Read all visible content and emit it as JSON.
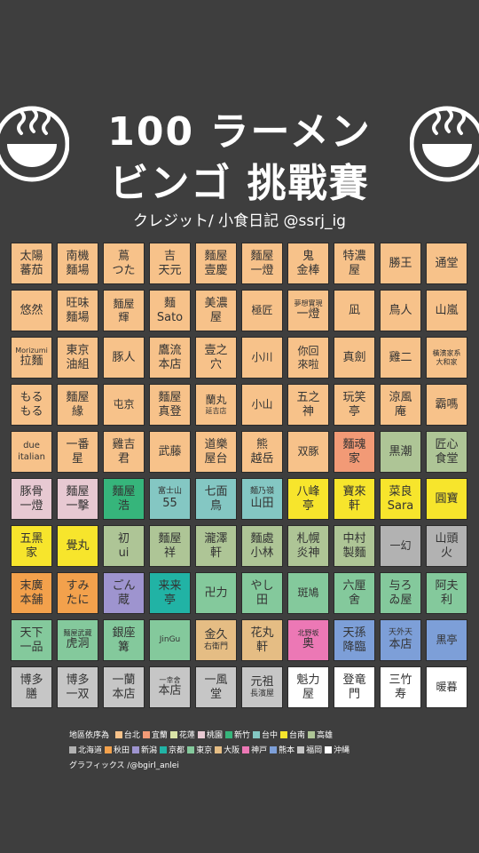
{
  "header": {
    "title_line1": "100 ラーメン",
    "title_line2": "ビンゴ 挑戰賽",
    "credit": "クレジット/ 小食日記 @ssrj_ig"
  },
  "colors": {
    "background": "#3e3e3e",
    "taipei": "#f7c28a",
    "yilan": "#f29a76",
    "hualien": "#d9e4a7",
    "taoyuan": "#e7c9d2",
    "hsinchu": "#36b57b",
    "taichung": "#84c7c3",
    "tainan": "#f7e52c",
    "kaohsiung": "#aec596",
    "hokkaido": "#b2b2b2",
    "akita": "#f3a14c",
    "niigata": "#9e94cf",
    "kyoto": "#21b3a5",
    "tokyo": "#84c99c",
    "osaka": "#e5bd84",
    "kobe": "#ec78b5",
    "kumamoto": "#7d9fd8",
    "fukuoka": "#c6c6c6",
    "okinawa": "#ffffff"
  },
  "cells": [
    {
      "lines": [
        "太陽",
        "蕃茄"
      ],
      "color": "#f7c28a",
      "size": 13
    },
    {
      "lines": [
        "南機",
        "麵場"
      ],
      "color": "#f7c28a",
      "size": 13
    },
    {
      "lines": [
        "蔦",
        "つた"
      ],
      "color": "#f7c28a",
      "size": 13
    },
    {
      "lines": [
        "吉",
        "天元"
      ],
      "color": "#f7c28a",
      "size": 13
    },
    {
      "lines": [
        "麵屋",
        "壹慶"
      ],
      "color": "#f7c28a",
      "size": 13
    },
    {
      "lines": [
        "麵屋",
        "一燈"
      ],
      "color": "#f7c28a",
      "size": 13
    },
    {
      "lines": [
        "鬼",
        "金棒"
      ],
      "color": "#f7c28a",
      "size": 13
    },
    {
      "lines": [
        "特濃",
        "屋"
      ],
      "color": "#f7c28a",
      "size": 13
    },
    {
      "lines": [
        "勝王"
      ],
      "color": "#f7c28a",
      "size": 13
    },
    {
      "lines": [
        "通堂"
      ],
      "color": "#f7c28a",
      "size": 13
    },
    {
      "lines": [
        "悠然"
      ],
      "color": "#f7c28a",
      "size": 13
    },
    {
      "lines": [
        "旺味",
        "麵場"
      ],
      "color": "#f7c28a",
      "size": 13
    },
    {
      "lines": [
        "麵屋",
        "輝"
      ],
      "color": "#f7c28a",
      "size": 12
    },
    {
      "lines": [
        "麵",
        "Sato"
      ],
      "color": "#f7c28a",
      "size": 13
    },
    {
      "lines": [
        "美濃",
        "屋"
      ],
      "color": "#f7c28a",
      "size": 13
    },
    {
      "lines": [
        "極匠"
      ],
      "color": "#f7c28a",
      "size": 12
    },
    {
      "lines": [
        "夢想實現",
        "一燈"
      ],
      "color": "#f7c28a",
      "size": 8,
      "size2": 13
    },
    {
      "lines": [
        "凪"
      ],
      "color": "#f7c28a",
      "size": 13
    },
    {
      "lines": [
        "鳥人"
      ],
      "color": "#f7c28a",
      "size": 13
    },
    {
      "lines": [
        "山嵐"
      ],
      "color": "#f7c28a",
      "size": 13
    },
    {
      "lines": [
        "Morizumi",
        "拉麵"
      ],
      "color": "#f7c28a",
      "size": 8,
      "size2": 13
    },
    {
      "lines": [
        "東京",
        "油組"
      ],
      "color": "#f7c28a",
      "size": 13
    },
    {
      "lines": [
        "豚人"
      ],
      "color": "#f7c28a",
      "size": 13
    },
    {
      "lines": [
        "鷹流",
        "本店"
      ],
      "color": "#f7c28a",
      "size": 13
    },
    {
      "lines": [
        "壹之",
        "穴"
      ],
      "color": "#f7c28a",
      "size": 13
    },
    {
      "lines": [
        "小川"
      ],
      "color": "#f7c28a",
      "size": 12
    },
    {
      "lines": [
        "你回",
        "來啦"
      ],
      "color": "#f7c28a",
      "size": 12
    },
    {
      "lines": [
        "真劍"
      ],
      "color": "#f7c28a",
      "size": 13
    },
    {
      "lines": [
        "雞二"
      ],
      "color": "#f7c28a",
      "size": 13
    },
    {
      "lines": [
        "橫濱家系",
        "大和家"
      ],
      "color": "#f7c28a",
      "size": 8
    },
    {
      "lines": [
        "もる",
        "もる"
      ],
      "color": "#f7c28a",
      "size": 13
    },
    {
      "lines": [
        "麵屋",
        "緣"
      ],
      "color": "#f7c28a",
      "size": 13
    },
    {
      "lines": [
        "屯京"
      ],
      "color": "#f7c28a",
      "size": 12
    },
    {
      "lines": [
        "麵屋",
        "真登"
      ],
      "color": "#f7c28a",
      "size": 13
    },
    {
      "lines": [
        "蘭丸",
        "延吉店"
      ],
      "color": "#f7c28a",
      "size": 12,
      "size2": 8
    },
    {
      "lines": [
        "小山"
      ],
      "color": "#f7c28a",
      "size": 12
    },
    {
      "lines": [
        "五之",
        "神"
      ],
      "color": "#f7c28a",
      "size": 13
    },
    {
      "lines": [
        "玩笑",
        "亭"
      ],
      "color": "#f7c28a",
      "size": 13
    },
    {
      "lines": [
        "涼風",
        "庵"
      ],
      "color": "#f7c28a",
      "size": 13
    },
    {
      "lines": [
        "霸嗎"
      ],
      "color": "#f7c28a",
      "size": 13
    },
    {
      "lines": [
        "due",
        "italian"
      ],
      "color": "#f7c28a",
      "size": 10
    },
    {
      "lines": [
        "一番",
        "星"
      ],
      "color": "#f7c28a",
      "size": 13
    },
    {
      "lines": [
        "雞吉",
        "君"
      ],
      "color": "#f7c28a",
      "size": 13
    },
    {
      "lines": [
        "武藤"
      ],
      "color": "#f7c28a",
      "size": 13
    },
    {
      "lines": [
        "道樂",
        "屋台"
      ],
      "color": "#f7c28a",
      "size": 13
    },
    {
      "lines": [
        "熊",
        "越岳"
      ],
      "color": "#f7c28a",
      "size": 13
    },
    {
      "lines": [
        "双豚"
      ],
      "color": "#f7c28a",
      "size": 12
    },
    {
      "lines": [
        "麵魂",
        "家"
      ],
      "color": "#f29a76",
      "size": 13
    },
    {
      "lines": [
        "黒潮"
      ],
      "color": "#aec596",
      "size": 13
    },
    {
      "lines": [
        "匠心",
        "食堂"
      ],
      "color": "#aec596",
      "size": 13
    },
    {
      "lines": [
        "豚骨",
        "一燈"
      ],
      "color": "#e7c9d2",
      "size": 13
    },
    {
      "lines": [
        "麵屋",
        "一擊"
      ],
      "color": "#e7c9d2",
      "size": 13
    },
    {
      "lines": [
        "麵屋",
        "浩"
      ],
      "color": "#36b57b",
      "size": 13
    },
    {
      "lines": [
        "富士山",
        "55"
      ],
      "color": "#84c7c3",
      "size": 9,
      "size2": 13
    },
    {
      "lines": [
        "七面",
        "鳥"
      ],
      "color": "#84c7c3",
      "size": 13
    },
    {
      "lines": [
        "麵乃嶺",
        "山田"
      ],
      "color": "#84c7c3",
      "size": 9,
      "size2": 13
    },
    {
      "lines": [
        "八峰",
        "亭"
      ],
      "color": "#f7e52c",
      "size": 13
    },
    {
      "lines": [
        "寶來",
        "軒"
      ],
      "color": "#f7e52c",
      "size": 13
    },
    {
      "lines": [
        "菜良",
        "Sara"
      ],
      "color": "#f7e52c",
      "size": 13
    },
    {
      "lines": [
        "圓寶"
      ],
      "color": "#f7e52c",
      "size": 13
    },
    {
      "lines": [
        "五黑",
        "家"
      ],
      "color": "#f7e52c",
      "size": 13
    },
    {
      "lines": [
        "覺丸"
      ],
      "color": "#f7e52c",
      "size": 13
    },
    {
      "lines": [
        "初",
        "ui"
      ],
      "color": "#aec596",
      "size": 13
    },
    {
      "lines": [
        "麵屋",
        "祥"
      ],
      "color": "#aec596",
      "size": 13
    },
    {
      "lines": [
        "瀧澤",
        "軒"
      ],
      "color": "#aec596",
      "size": 13
    },
    {
      "lines": [
        "麵處",
        "小林"
      ],
      "color": "#aec596",
      "size": 13
    },
    {
      "lines": [
        "札幌",
        "炎神"
      ],
      "color": "#aec596",
      "size": 13
    },
    {
      "lines": [
        "中村",
        "製麵"
      ],
      "color": "#aec596",
      "size": 13
    },
    {
      "lines": [
        "一幻"
      ],
      "color": "#b2b2b2",
      "size": 12
    },
    {
      "lines": [
        "山頭",
        "火"
      ],
      "color": "#b2b2b2",
      "size": 13
    },
    {
      "lines": [
        "末廣",
        "本舗"
      ],
      "color": "#f3a14c",
      "size": 13
    },
    {
      "lines": [
        "すみ",
        "たに"
      ],
      "color": "#f3a14c",
      "size": 13
    },
    {
      "lines": [
        "ごん",
        "蔵"
      ],
      "color": "#9e94cf",
      "size": 13
    },
    {
      "lines": [
        "来来",
        "亭"
      ],
      "color": "#21b3a5",
      "size": 13
    },
    {
      "lines": [
        "卍力"
      ],
      "color": "#84c99c",
      "size": 13
    },
    {
      "lines": [
        "やし",
        "田"
      ],
      "color": "#84c99c",
      "size": 13
    },
    {
      "lines": [
        "斑鳩"
      ],
      "color": "#84c99c",
      "size": 12
    },
    {
      "lines": [
        "六厘",
        "舍"
      ],
      "color": "#84c99c",
      "size": 13
    },
    {
      "lines": [
        "与ろ",
        "ゐ屋"
      ],
      "color": "#84c99c",
      "size": 13
    },
    {
      "lines": [
        "阿夫",
        "利"
      ],
      "color": "#84c99c",
      "size": 13
    },
    {
      "lines": [
        "天下",
        "一品"
      ],
      "color": "#84c99c",
      "size": 13
    },
    {
      "lines": [
        "麵屋武藏",
        "虎洞"
      ],
      "color": "#84c99c",
      "size": 8,
      "size2": 13
    },
    {
      "lines": [
        "銀座",
        "篝"
      ],
      "color": "#84c99c",
      "size": 13
    },
    {
      "lines": [
        "JinGu"
      ],
      "color": "#84c99c",
      "size": 9
    },
    {
      "lines": [
        "金久",
        "右衛門"
      ],
      "color": "#e5bd84",
      "size": 13,
      "size2": 9
    },
    {
      "lines": [
        "花丸",
        "軒"
      ],
      "color": "#e5bd84",
      "size": 13
    },
    {
      "lines": [
        "北野坂",
        "奥"
      ],
      "color": "#ec78b5",
      "size": 8,
      "size2": 13
    },
    {
      "lines": [
        "天孫",
        "降臨"
      ],
      "color": "#7d9fd8",
      "size": 13
    },
    {
      "lines": [
        "天外天",
        "本店"
      ],
      "color": "#7d9fd8",
      "size": 9,
      "size2": 13
    },
    {
      "lines": [
        "黒亭"
      ],
      "color": "#7d9fd8",
      "size": 12
    },
    {
      "lines": [
        "博多",
        "膳"
      ],
      "color": "#c6c6c6",
      "size": 13
    },
    {
      "lines": [
        "博多",
        "一双"
      ],
      "color": "#c6c6c6",
      "size": 13
    },
    {
      "lines": [
        "一蘭",
        "本店"
      ],
      "color": "#c6c6c6",
      "size": 13
    },
    {
      "lines": [
        "一幸舍",
        "本店"
      ],
      "color": "#c6c6c6",
      "size": 8,
      "size2": 13
    },
    {
      "lines": [
        "一風",
        "堂"
      ],
      "color": "#c6c6c6",
      "size": 13
    },
    {
      "lines": [
        "元祖",
        "長濱屋"
      ],
      "color": "#c6c6c6",
      "size": 13,
      "size2": 9
    },
    {
      "lines": [
        "魁力",
        "屋"
      ],
      "color": "#ffffff",
      "size": 13
    },
    {
      "lines": [
        "登竜",
        "門"
      ],
      "color": "#ffffff",
      "size": 13
    },
    {
      "lines": [
        "三竹",
        "寿"
      ],
      "color": "#ffffff",
      "size": 13
    },
    {
      "lines": [
        "暖暮"
      ],
      "color": "#ffffff",
      "size": 12
    }
  ],
  "legend": {
    "title": "地區依序為",
    "items": [
      {
        "label": "台北",
        "color": "#f7c28a"
      },
      {
        "label": "宜蘭",
        "color": "#f29a76"
      },
      {
        "label": "花蓮",
        "color": "#d9e4a7"
      },
      {
        "label": "桃園",
        "color": "#e7c9d2"
      },
      {
        "label": "新竹",
        "color": "#36b57b"
      },
      {
        "label": "台中",
        "color": "#84c7c3"
      },
      {
        "label": "台南",
        "color": "#f7e52c"
      },
      {
        "label": "高雄",
        "color": "#aec596"
      },
      {
        "label": "北海道",
        "color": "#b2b2b2"
      },
      {
        "label": "秋田",
        "color": "#f3a14c"
      },
      {
        "label": "新潟",
        "color": "#9e94cf"
      },
      {
        "label": "京都",
        "color": "#21b3a5"
      },
      {
        "label": "東京",
        "color": "#84c99c"
      },
      {
        "label": "大阪",
        "color": "#e5bd84"
      },
      {
        "label": "神戸",
        "color": "#ec78b5"
      },
      {
        "label": "熊本",
        "color": "#7d9fd8"
      },
      {
        "label": "福岡",
        "color": "#c6c6c6"
      },
      {
        "label": "沖縄",
        "color": "#ffffff"
      }
    ],
    "graphics": "グラフィックス /@bgirl_anlei"
  }
}
